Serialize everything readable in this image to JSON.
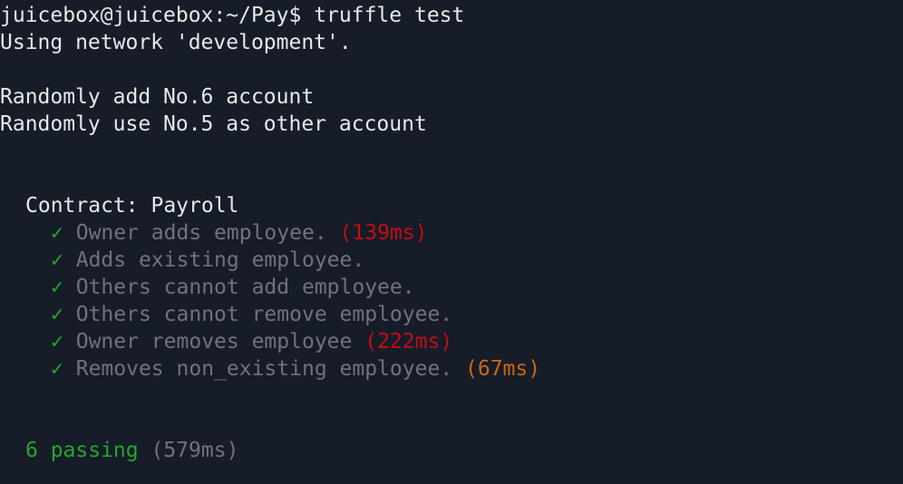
{
  "terminal": {
    "prompt": "juicebox@juicebox:~/Pay$",
    "command": " truffle test",
    "network_line": "Using network 'development'.",
    "info_lines": [
      "Randomly add No.6 account",
      "Randomly use No.5 as other account"
    ],
    "suite_title": "Contract: Payroll",
    "check_mark": "✓",
    "tests": [
      {
        "name": "Owner adds employee.",
        "duration": "(139ms)",
        "duration_color": "#c30d10"
      },
      {
        "name": "Adds existing employee.",
        "duration": "",
        "duration_color": ""
      },
      {
        "name": "Others cannot add employee.",
        "duration": "",
        "duration_color": ""
      },
      {
        "name": "Others cannot remove employee.",
        "duration": "",
        "duration_color": ""
      },
      {
        "name": "Owner removes employee",
        "duration": "(222ms)",
        "duration_color": "#c30d10"
      },
      {
        "name": "Removes non_existing employee.",
        "duration": "(67ms)",
        "duration_color": "#c8680f"
      }
    ],
    "summary": {
      "passing": "6 passing",
      "total_time": "(579ms)"
    },
    "colors": {
      "background": "#171c29",
      "text": "#e8e8e8",
      "pass": "#23a62a",
      "muted": "#6f737b",
      "slow": "#c30d10",
      "medium": "#c8680f"
    }
  }
}
